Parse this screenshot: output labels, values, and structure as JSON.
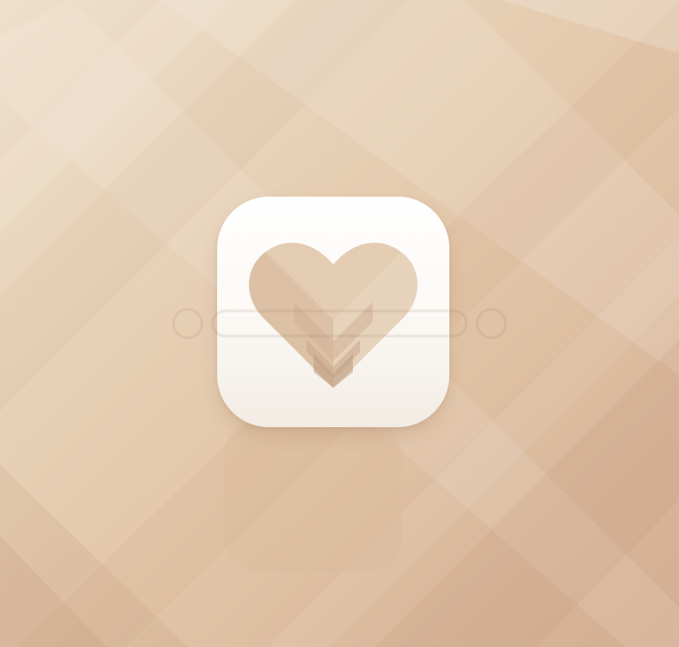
{
  "scene": {
    "background_colors": [
      "#ecdcc6",
      "#e3c9ad",
      "#ddbfa2",
      "#d6b39a"
    ],
    "icon_semantic": "heart-icon",
    "icon_background_color": "#ffffff",
    "heart_colors": [
      "#e3ccb2",
      "#d7bc9f",
      "#cdb096"
    ]
  }
}
